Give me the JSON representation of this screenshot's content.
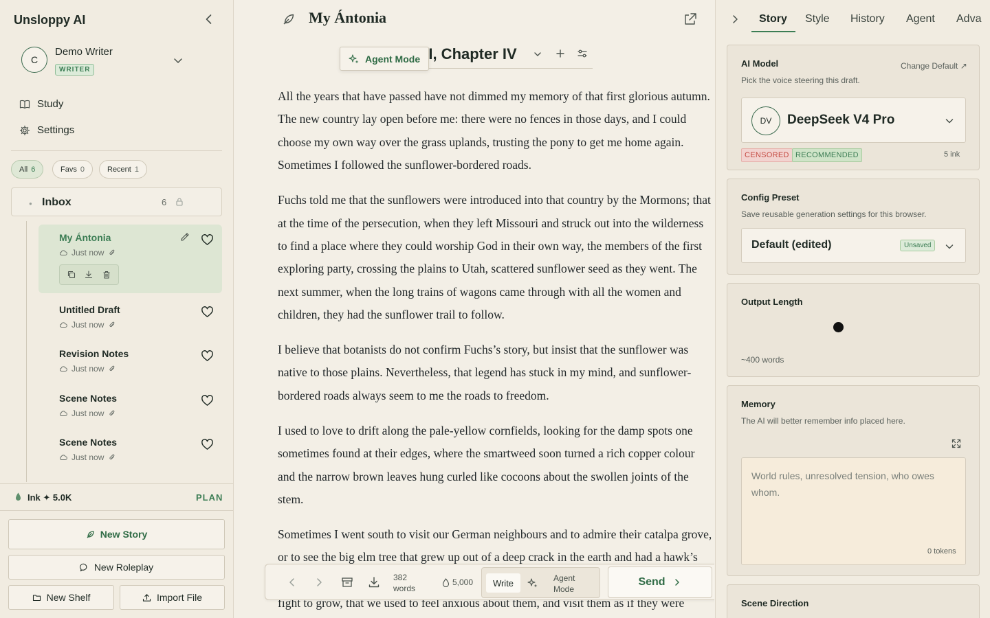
{
  "sidebar": {
    "brand": "Unsloppy AI",
    "user": {
      "initial": "C",
      "name": "Demo Writer",
      "role": "WRITER"
    },
    "nav": [
      {
        "label": "Study",
        "icon": "book-icon"
      },
      {
        "label": "Settings",
        "icon": "gear-icon"
      }
    ],
    "filters": [
      {
        "label": "All",
        "count": "6"
      },
      {
        "label": "Favs",
        "count": "0"
      },
      {
        "label": "Recent",
        "count": "1"
      }
    ],
    "inbox": {
      "label": "Inbox",
      "count": "6"
    },
    "stories": [
      {
        "title": "My Ántonia",
        "time": "Just now"
      },
      {
        "title": "Untitled Draft",
        "time": "Just now"
      },
      {
        "title": "Revision Notes",
        "time": "Just now"
      },
      {
        "title": "Scene Notes",
        "time": "Just now"
      },
      {
        "title": "Scene Notes",
        "time": "Just now"
      }
    ],
    "ink": "Ink ✦ 5.0K",
    "plan_label": "PLAN",
    "buttons": {
      "new_story": "New Story",
      "new_roleplay": "New Roleplay",
      "new_shelf": "New Shelf",
      "import_file": "Import File"
    }
  },
  "editor": {
    "doc_title": "My Ántonia",
    "chapter_title": "k I, Chapter IV",
    "agent_mode_popover": "Agent Mode",
    "paragraphs": [
      "All the years that have passed have not dimmed my memory of that first glorious autumn. The new country lay open before me: there were no fences in those days, and I could choose my own way over the grass uplands, trusting the pony to get me home again. Sometimes I followed the sunflower-bordered roads.",
      "Fuchs told me that the sunflowers were introduced into that country by the Mormons; that at the time of the persecution, when they left Missouri and struck out into the wilderness to find a place where they could worship God in their own way, the members of the first exploring party, crossing the plains to Utah, scattered sunflower seed as they went. The next summer, when the long trains of wagons came through with all the women and children, they had the sunflower trail to follow.",
      "I believe that botanists do not confirm Fuchs’s story, but insist that the sunflower was native to those plains. Nevertheless, that legend has stuck in my mind, and sunflower-bordered roads always seem to me the roads to freedom.",
      "I used to love to drift along the pale-yellow cornfields, looking for the damp spots one sometimes found at their edges, where the smartweed soon turned a rich copper colour and the narrow brown leaves hung curled like cocoons about the swollen joints of the stem.",
      "Sometimes I went south to visit our German neighbours and to admire their catalpa grove, or to see the big elm tree that grew up out of a deep crack in the earth and had a hawk’s nest in its branches. Trees were so rare in that country, and they had to make such a hard fight to grow, that we used to feel anxious about them, and visit them as if they were"
    ],
    "toolbar": {
      "word_count": "382",
      "word_unit": "words",
      "ink": "5,000",
      "write_label": "Write",
      "agent_line1": "Agent",
      "agent_line2": "Mode",
      "send_label": "Send"
    }
  },
  "right_panel": {
    "tabs": [
      "Story",
      "Style",
      "History",
      "Agent",
      "Adva"
    ],
    "active_tab": "Story",
    "ai_model": {
      "title": "AI Model",
      "change_default": "Change Default ↗",
      "subtitle": "Pick the voice steering this draft.",
      "avatar": "DV",
      "model_name": "DeepSeek V4 Pro",
      "badge_censored": "CENSORED",
      "badge_recommended": "RECOMMENDED",
      "ink_cost": "5 ink"
    },
    "config_preset": {
      "title": "Config Preset",
      "subtitle": "Save reusable generation settings for this browser.",
      "value": "Default (edited)",
      "badge": "Unsaved"
    },
    "output_length": {
      "title": "Output Length",
      "slider_fraction": 0.43,
      "value_label": "~400 words"
    },
    "memory": {
      "title": "Memory",
      "subtitle": "The AI will better remember info placed here.",
      "placeholder": "World rules, unresolved tension, who owes whom.",
      "tokens": "0 tokens"
    },
    "scene_direction": {
      "title": "Scene Direction"
    }
  },
  "colors": {
    "accent": "#3c7d54",
    "background": "#f3efe6",
    "censored": "#c44a42"
  }
}
